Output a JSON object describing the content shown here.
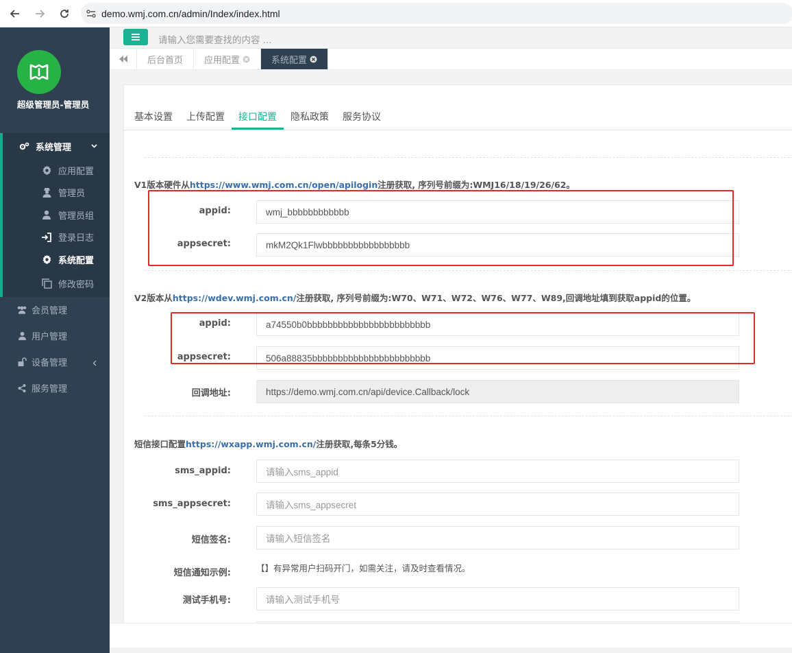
{
  "browser": {
    "url": "demo.wmj.com.cn/admin/Index/index.html"
  },
  "sidebar": {
    "user_name": "超级管理员-管理员",
    "group_label": "系统管理",
    "group_items": [
      {
        "label": "应用配置",
        "icon": "gear-icon"
      },
      {
        "label": "管理员",
        "icon": "user-secret-icon"
      },
      {
        "label": "管理员组",
        "icon": "user-icon"
      },
      {
        "label": "登录日志",
        "icon": "sign-in-icon"
      },
      {
        "label": "系统配置",
        "icon": "gear-icon",
        "active": true
      },
      {
        "label": "修改密码",
        "icon": "copy-icon"
      }
    ],
    "items": [
      {
        "label": "会员管理",
        "icon": "users-icon"
      },
      {
        "label": "用户管理",
        "icon": "user-icon"
      },
      {
        "label": "设备管理",
        "icon": "unlock-icon"
      },
      {
        "label": "服务管理",
        "icon": "share-icon"
      }
    ],
    "accent_color": "#1ab394",
    "bg_color": "#2f4050"
  },
  "header": {
    "search_placeholder": "请输入您需要查找的内容 ..."
  },
  "page_tabs": [
    {
      "label": "后台首页"
    },
    {
      "label": "应用配置"
    },
    {
      "label": "系统配置",
      "active": true
    }
  ],
  "config_tabs": [
    "基本设置",
    "上传配置",
    "接口配置",
    "隐私政策",
    "服务协议"
  ],
  "v1": {
    "title_prefix": "V1版本硬件从",
    "title_link": "https://www.wmj.com.cn/open/apilogin",
    "title_suffix": "注册获取, 序列号前缀为:WMJ16/18/19/26/62。",
    "appid_label": "appid:",
    "appid_value": "wmj_bbbbbbbbbbbb",
    "appsecret_label": "appsecret:",
    "appsecret_value": "mkM2Qk1Flwbbbbbbbbbbbbbbbbb"
  },
  "v2": {
    "title_prefix": "V2版本从",
    "title_link": "https://wdev.wmj.com.cn/",
    "title_suffix": "注册获取, 序列号前缀为:W70、W71、W72、W76、W77、W89,回调地址填到获取appid的位置。",
    "appid_label": "appid:",
    "appid_value": "a74550b0bbbbbbbbbbbbbbbbbbbbbbbb",
    "appsecret_label": "appsecret:",
    "appsecret_value": "506a88835bbbbbbbbbbbbbbbbbbbbbbb",
    "callback_label": "回调地址:",
    "callback_value": "https://demo.wmj.com.cn/api/device.Callback/lock"
  },
  "sms": {
    "title_prefix": "短信接口配置",
    "title_link": "https://wxapp.wmj.com.cn/",
    "title_suffix": "注册获取,每条5分钱。",
    "fields": [
      {
        "label": "sms_appid:",
        "placeholder": "请输入sms_appid"
      },
      {
        "label": "sms_appsecret:",
        "placeholder": "请输入sms_appsecret"
      },
      {
        "label": "短信签名:",
        "placeholder": "请输入短信签名"
      }
    ],
    "example_label": "短信通知示例:",
    "example_text": "【】有异常用户扫码开门，如需关注，请及时查看情况。",
    "phone_label": "测试手机号:",
    "phone_placeholder": "请输入测试手机号"
  }
}
